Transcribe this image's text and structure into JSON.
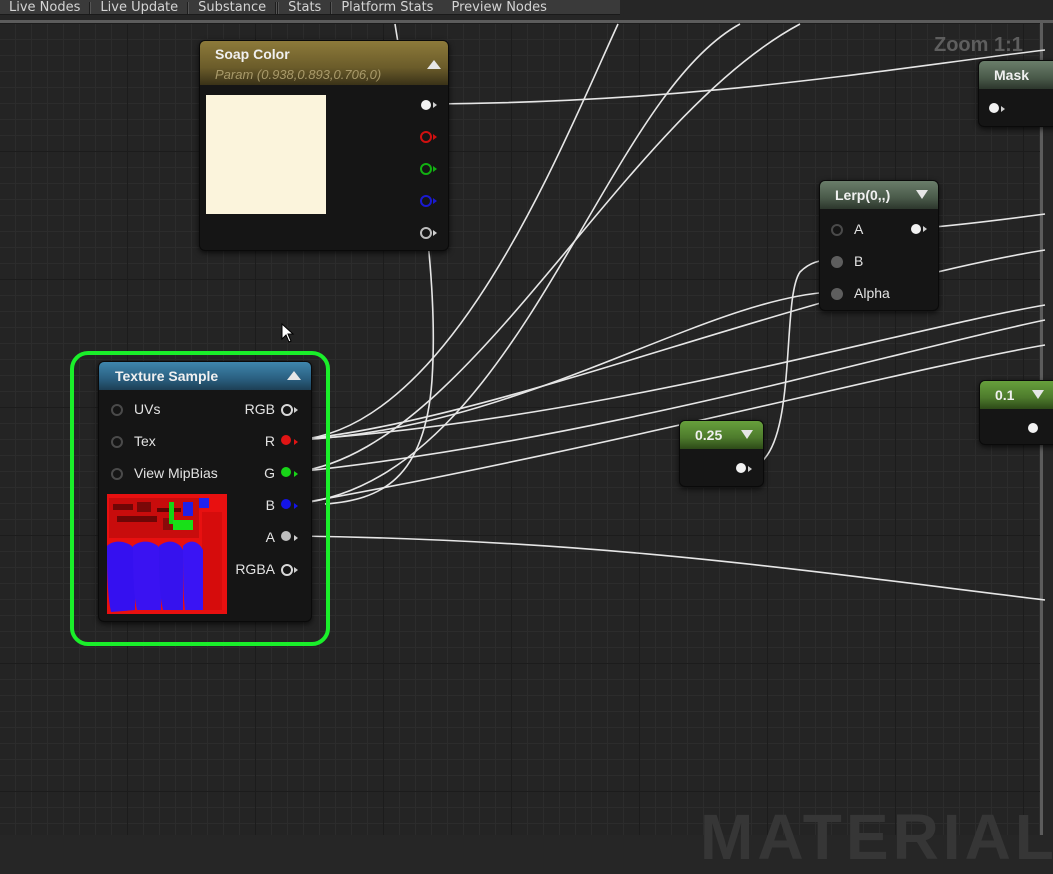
{
  "toolbar": {
    "items": [
      "Live Nodes",
      "Live Update",
      "Substance",
      "Stats",
      "Platform Stats",
      "Preview Nodes"
    ]
  },
  "graph": {
    "zoom_label": "Zoom 1:1",
    "watermark": "MATERIAL"
  },
  "nodes": {
    "soap_color": {
      "title": "Soap Color",
      "subtitle": "Param (0.938,0.893,0.706,0)",
      "swatch_color": "#fbf4dc",
      "header_color": "#7a6a32"
    },
    "texture_sample": {
      "title": "Texture Sample",
      "inputs": [
        "UVs",
        "Tex",
        "View MipBias"
      ],
      "outputs": [
        "RGB",
        "R",
        "G",
        "B",
        "A",
        "RGBA"
      ],
      "header_color": "#2b6a8c"
    },
    "lerp": {
      "title": "Lerp(0,,)",
      "inputs": [
        "A",
        "B",
        "Alpha"
      ]
    },
    "const_025": {
      "title": "0.25"
    },
    "const_01": {
      "title": "0.1"
    },
    "mask": {
      "title": "Mask"
    }
  },
  "colors": {
    "selection": "#1aef2a",
    "pin_red": "#e01414",
    "pin_green": "#18d418",
    "pin_blue": "#1414e6",
    "constant_header": "#4d7a2c"
  }
}
